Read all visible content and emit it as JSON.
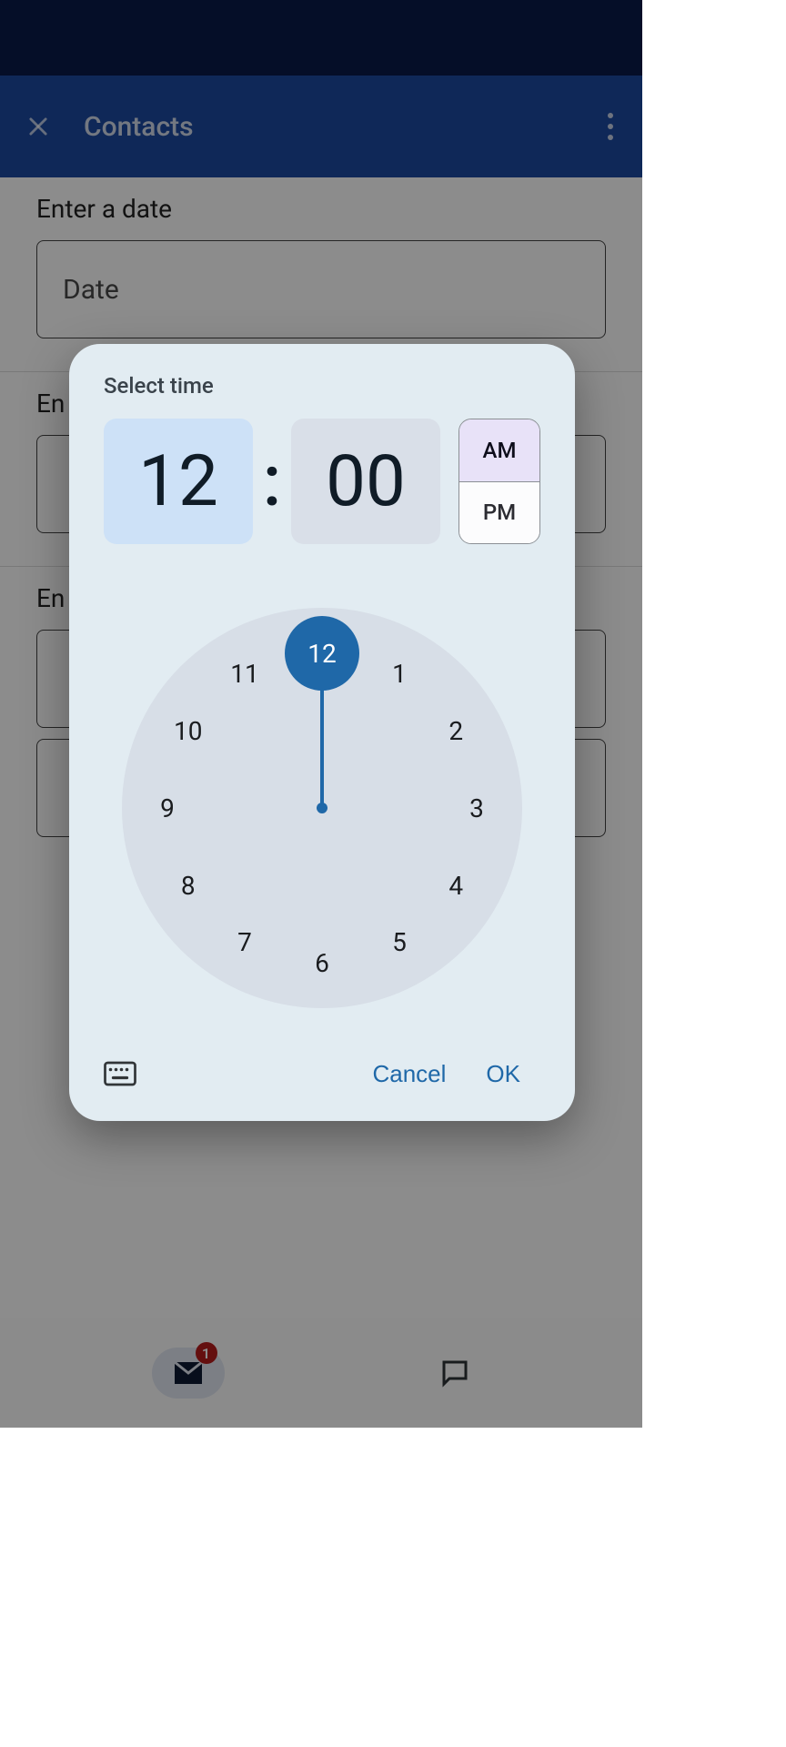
{
  "appbar": {
    "title": "Contacts"
  },
  "form": {
    "date_label": "Enter a date",
    "date_placeholder": "Date",
    "label2_prefix": "En",
    "label3_prefix": "En"
  },
  "nav": {
    "mail_badge": "1"
  },
  "picker": {
    "title": "Select time",
    "hour": "12",
    "minute": "00",
    "colon": ":",
    "am": "AM",
    "pm": "PM",
    "selected_period": "AM",
    "clock_numbers": [
      "12",
      "1",
      "2",
      "3",
      "4",
      "5",
      "6",
      "7",
      "8",
      "9",
      "10",
      "11"
    ],
    "selected_hour_index": 0,
    "cancel": "Cancel",
    "ok": "OK"
  },
  "colors": {
    "accent": "#1f68a8",
    "statusbar": "#0a1a4a",
    "appbar": "#1d4aa1"
  }
}
